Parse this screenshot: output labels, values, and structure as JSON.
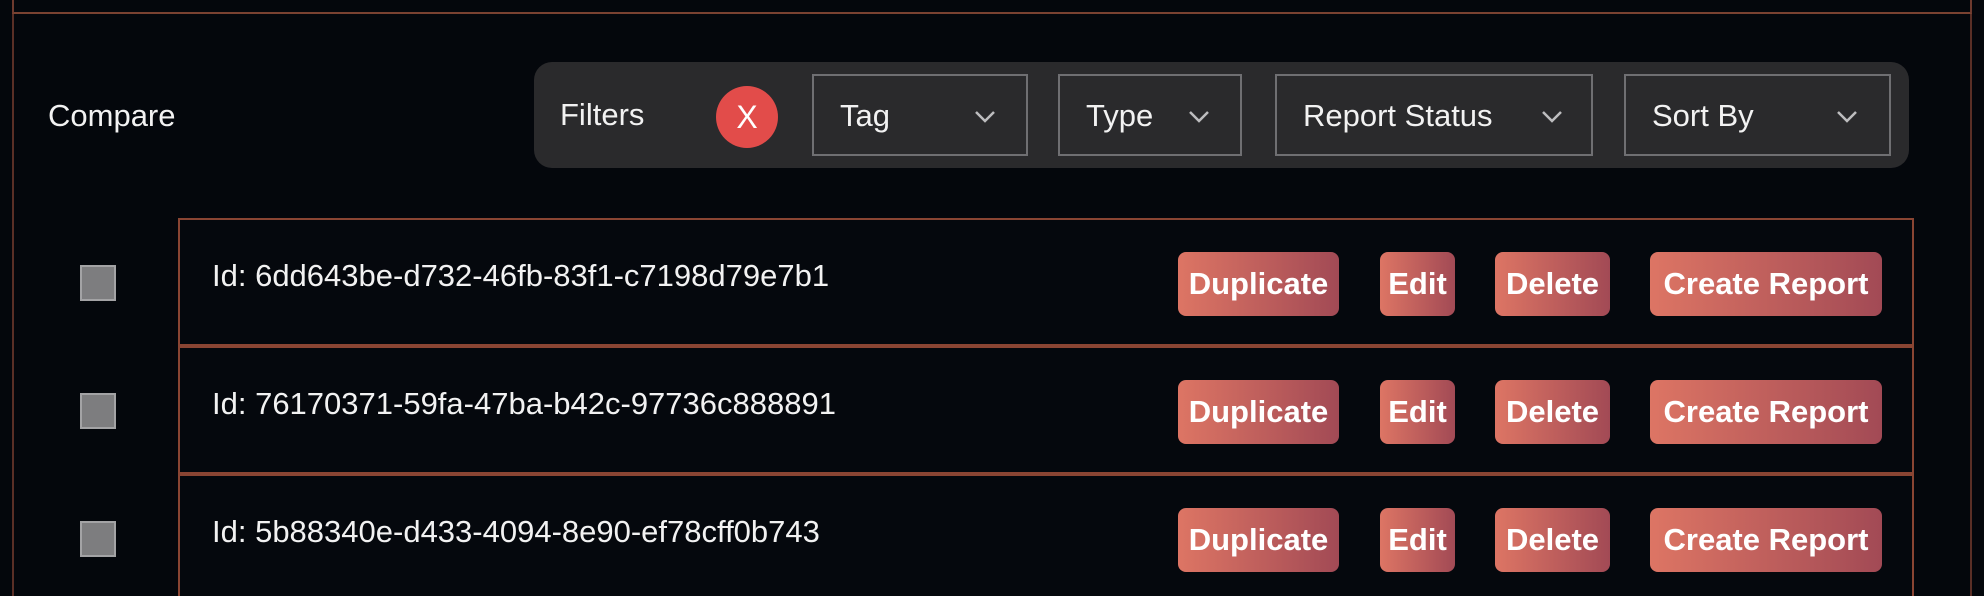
{
  "compare_label": "Compare",
  "filters": {
    "label": "Filters",
    "clear_label": "X",
    "tag": "Tag",
    "type": "Type",
    "report_status": "Report Status",
    "sort_by": "Sort By"
  },
  "rows": [
    {
      "id_text": "Id: 6dd643be-d732-46fb-83f1-c7198d79e7b1",
      "duplicate": "Duplicate",
      "edit": "Edit",
      "delete": "Delete",
      "create_report": "Create Report"
    },
    {
      "id_text": "Id: 76170371-59fa-47ba-b42c-97736c888891",
      "duplicate": "Duplicate",
      "edit": "Edit",
      "delete": "Delete",
      "create_report": "Create Report"
    },
    {
      "id_text": "Id: 5b88340e-d433-4094-8e90-ef78cff0b743",
      "duplicate": "Duplicate",
      "edit": "Edit",
      "delete": "Delete",
      "create_report": "Create Report"
    }
  ],
  "colors": {
    "background": "#04070c",
    "filter_bar": "#2a2a2c",
    "clear_button": "#e24c4a",
    "action_gradient_start": "#dd7564",
    "action_gradient_end": "#a24a55",
    "row_border": "#8a4533"
  },
  "icons": {
    "dropdown": "chevron-down-icon",
    "clear": "close-icon"
  }
}
